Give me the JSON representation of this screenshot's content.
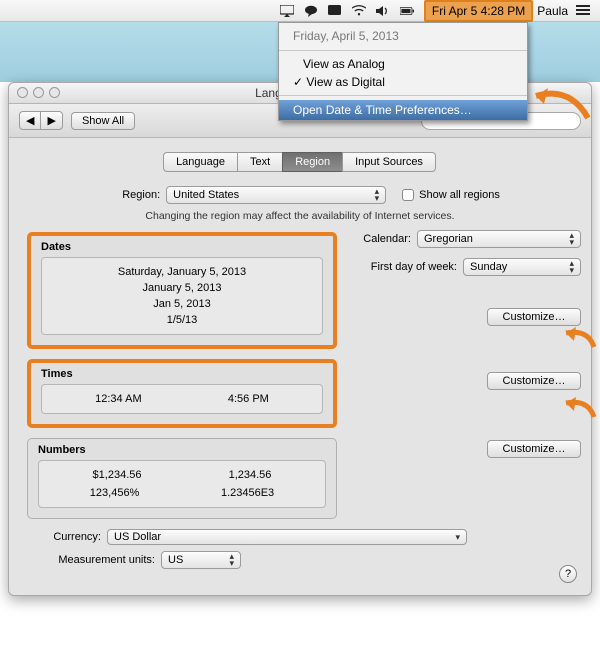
{
  "menubar": {
    "clock": "Fri Apr 5  4:28 PM",
    "username": "Paula"
  },
  "menu": {
    "full_date": "Friday, April 5, 2013",
    "view_analog": "View as Analog",
    "view_digital": "View as Digital",
    "open_prefs": "Open Date & Time Preferences…"
  },
  "window": {
    "title": "Language & Text",
    "toolbar": {
      "show_all": "Show All"
    },
    "tabs": [
      "Language",
      "Text",
      "Region",
      "Input Sources"
    ],
    "region": {
      "label": "Region:",
      "value": "United States",
      "show_all_regions": "Show all regions",
      "note": "Changing the region may affect the availability of Internet services."
    },
    "calendar": {
      "label": "Calendar:",
      "value": "Gregorian"
    },
    "first_day": {
      "label": "First day of week:",
      "value": "Sunday"
    },
    "dates": {
      "title": "Dates",
      "examples": [
        "Saturday, January 5, 2013",
        "January 5, 2013",
        "Jan 5, 2013",
        "1/5/13"
      ],
      "customize": "Customize…"
    },
    "times": {
      "title": "Times",
      "examples": [
        "12:34 AM",
        "4:56 PM"
      ],
      "customize": "Customize…"
    },
    "numbers": {
      "title": "Numbers",
      "examples": [
        [
          "$1,234.56",
          "1,234.56"
        ],
        [
          "123,456%",
          "1.23456E3"
        ]
      ],
      "customize": "Customize…"
    },
    "currency": {
      "label": "Currency:",
      "value": "US Dollar"
    },
    "units": {
      "label": "Measurement units:",
      "value": "US"
    }
  }
}
